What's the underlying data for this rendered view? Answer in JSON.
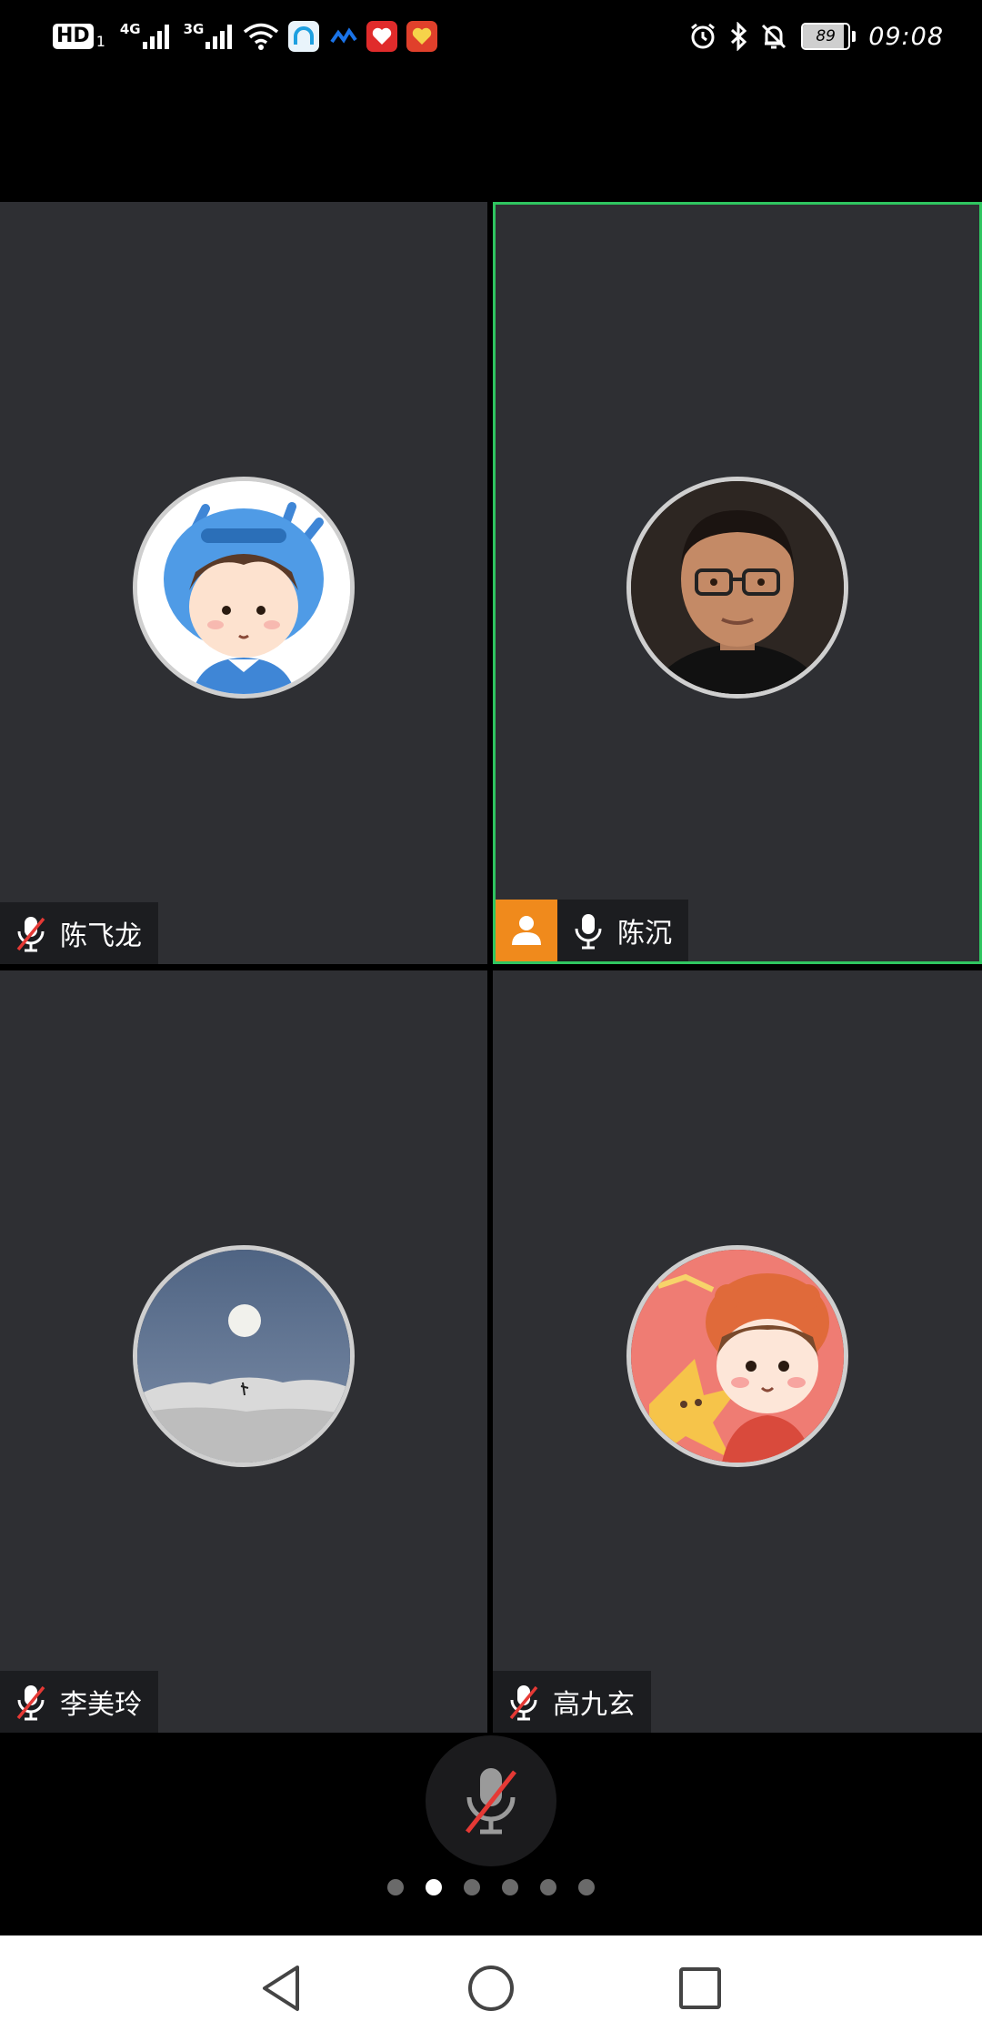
{
  "status_bar": {
    "hd_badge": "HD",
    "hd_sub": "1",
    "network_1": "4G",
    "network_2": "3G",
    "battery_level": "89",
    "time": "09:08",
    "icons": [
      "signal-icon",
      "signal-icon",
      "wifi-icon",
      "app-notification-icon",
      "app-notification-icon",
      "app-notification-icon",
      "app-notification-icon",
      "alarm-icon",
      "bluetooth-icon",
      "bell-muted-icon",
      "battery-icon"
    ]
  },
  "participants": [
    {
      "name": "陈飞龙",
      "mic": "muted",
      "is_host": false,
      "active_speaker": false,
      "avatar": "cartoon-boy-avatar"
    },
    {
      "name": "陈沉",
      "mic": "on",
      "is_host": true,
      "active_speaker": true,
      "avatar": "man-portrait-avatar"
    },
    {
      "name": "李美玲",
      "mic": "muted",
      "is_host": false,
      "active_speaker": false,
      "avatar": "moon-landscape-avatar"
    },
    {
      "name": "高九玄",
      "mic": "muted",
      "is_host": false,
      "active_speaker": false,
      "avatar": "cartoon-girl-avatar"
    }
  ],
  "controls": {
    "mic_state": "muted",
    "page_count": 6,
    "active_page": 2
  },
  "colors": {
    "tile_bg": "#2e2f33",
    "active_border": "#2fc560",
    "host_badge": "#f08a1c",
    "mute_slash": "#e53935"
  }
}
